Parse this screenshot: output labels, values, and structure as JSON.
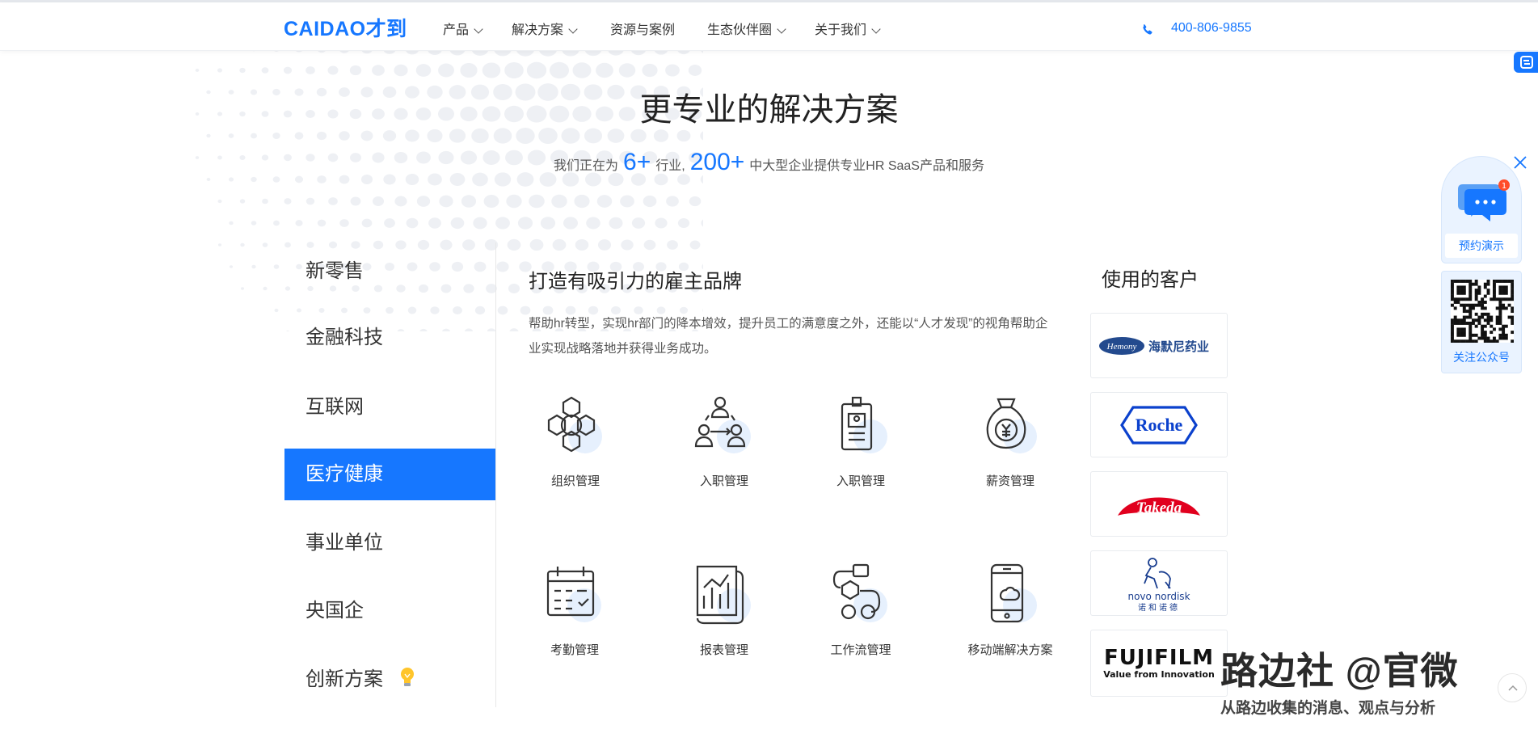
{
  "header": {
    "logo": "CAIDAO才到",
    "nav": [
      "产品",
      "解决方案",
      "资源与案例",
      "生态伙伴圈",
      "关于我们"
    ],
    "phone": "400-806-9855"
  },
  "hero": {
    "title": "更专业的解决方案",
    "subtitle_prefix": "我们正在为",
    "industries": "6+",
    "subtitle_mid": "行业,",
    "companies": "200+",
    "subtitle_suffix": "中大型企业提供专业HR SaaS产品和服务"
  },
  "sidebar": {
    "tabs": [
      "新零售",
      "金融科技",
      "互联网",
      "医疗健康",
      "事业单位",
      "央国企",
      "创新方案"
    ],
    "active_index": 3
  },
  "section": {
    "title": "打造有吸引力的雇主品牌",
    "description": "帮助hr转型，实现hr部门的降本增效，提升员工的满意度之外，还能以“人才发现”的视角帮助企业实现战略落地并获得业务成功。",
    "features": [
      {
        "label": "组织管理",
        "icon": "network-icon"
      },
      {
        "label": "入职管理",
        "icon": "people-flow-icon"
      },
      {
        "label": "入职管理",
        "icon": "badge-icon"
      },
      {
        "label": "薪资管理",
        "icon": "money-bag-icon"
      },
      {
        "label": "考勤管理",
        "icon": "calendar-icon"
      },
      {
        "label": "报表管理",
        "icon": "report-icon"
      },
      {
        "label": "工作流管理",
        "icon": "workflow-icon"
      },
      {
        "label": "移动端解决方案",
        "icon": "mobile-icon"
      }
    ]
  },
  "customers": {
    "title": "使用的客户",
    "logos": [
      {
        "oval_text": "Hemony",
        "text": "海默尼药业"
      },
      {
        "text": "Roche"
      },
      {
        "text": "Takeda"
      },
      {
        "text": "novo nordisk",
        "sub": "诺和诺德"
      },
      {
        "text": "FUJIFILM",
        "sub": "Value from Innovation"
      }
    ]
  },
  "floating": {
    "chat_badge": "1",
    "book_demo": "预约演示",
    "follow": "关注公众号"
  },
  "watermark": {
    "main": "路边社 @官微",
    "sub": "从路边收集的消息、观点与分析"
  },
  "colors": {
    "accent": "#1677ff",
    "roche": "#0b41cd",
    "takeda": "#e1001e"
  }
}
